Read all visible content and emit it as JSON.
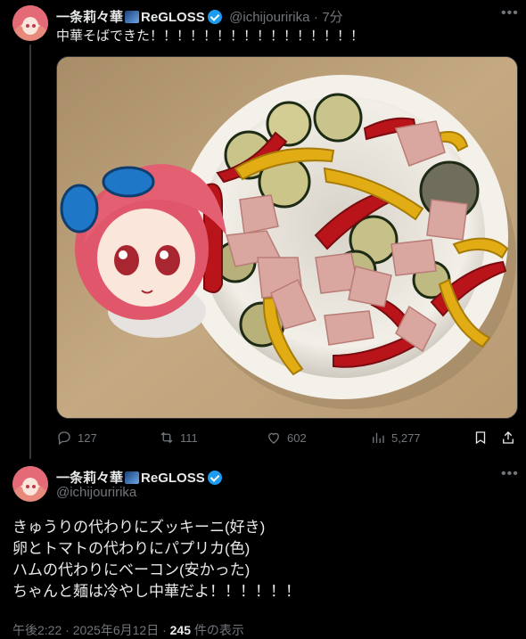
{
  "tweet1": {
    "display_name": "一条莉々華",
    "display_name_suffix": "ReGLOSS",
    "handle": "@ichijouririka",
    "time_sep": "·",
    "time": "7分",
    "text": "中華そばできた！！！！！！！！！！！！！！！！",
    "image_alt": "plush doll next to a bowl of grilled zucchini, bell peppers and bacon",
    "actions": {
      "replies": "127",
      "reposts": "111",
      "likes": "602",
      "views": "5,277"
    }
  },
  "tweet2": {
    "display_name": "一条莉々華",
    "display_name_suffix": "ReGLOSS",
    "handle": "@ichijouririka",
    "lines": [
      "きゅうりの代わりにズッキーニ(好き)",
      "卵とトマトの代わりにパプリカ(色)",
      "ハムの代わりにベーコン(安かった)",
      "ちゃんと麺は冷やし中華だよ！！！！！！"
    ],
    "timestamp": "午後2:22 · 2025年6月12日 · ",
    "view_count": "245",
    "view_suffix": " 件の表示"
  },
  "icons": {
    "more": "more-icon",
    "reply": "reply-icon",
    "repost": "repost-icon",
    "like": "heart-icon",
    "views": "views-icon",
    "bookmark": "bookmark-icon",
    "share": "share-icon",
    "verified": "verified-badge-icon"
  },
  "colors": {
    "background": "#000000",
    "text": "#e7e9ea",
    "muted": "#71767b",
    "verified": "#1d9bf0"
  }
}
